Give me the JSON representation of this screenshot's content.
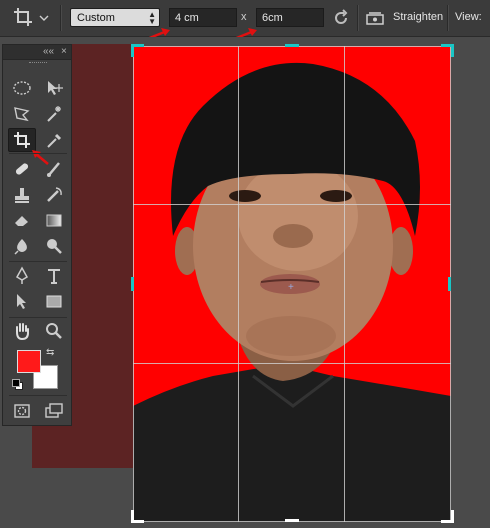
{
  "options_bar": {
    "preset_value": "Custom",
    "width_value": "4 cm",
    "height_value": "6cm",
    "separator": "x",
    "straighten_label": "Straighten",
    "view_label": "View:"
  },
  "colors": {
    "foreground": "#ff1a1a",
    "background": "#ffffff",
    "photo_background": "#ff0000",
    "crop_handle": "#19c6c6",
    "annotation_arrow": "#e01010"
  },
  "tools_panel": {
    "collapse_glyph": "««",
    "close_glyph": "×",
    "tools": [
      "elliptical-marquee-icon",
      "move-icon",
      "polygonal-lasso-icon",
      "magic-wand-icon",
      "crop-icon",
      "eyedropper-icon",
      "spot-healing-brush-icon",
      "brush-icon",
      "clone-stamp-icon",
      "history-brush-icon",
      "eraser-icon",
      "gradient-icon",
      "blur-icon",
      "dodge-icon",
      "pen-icon",
      "type-icon",
      "path-selection-icon",
      "rectangle-shape-icon",
      "hand-icon",
      "zoom-icon"
    ],
    "active_tool": "crop-icon"
  }
}
